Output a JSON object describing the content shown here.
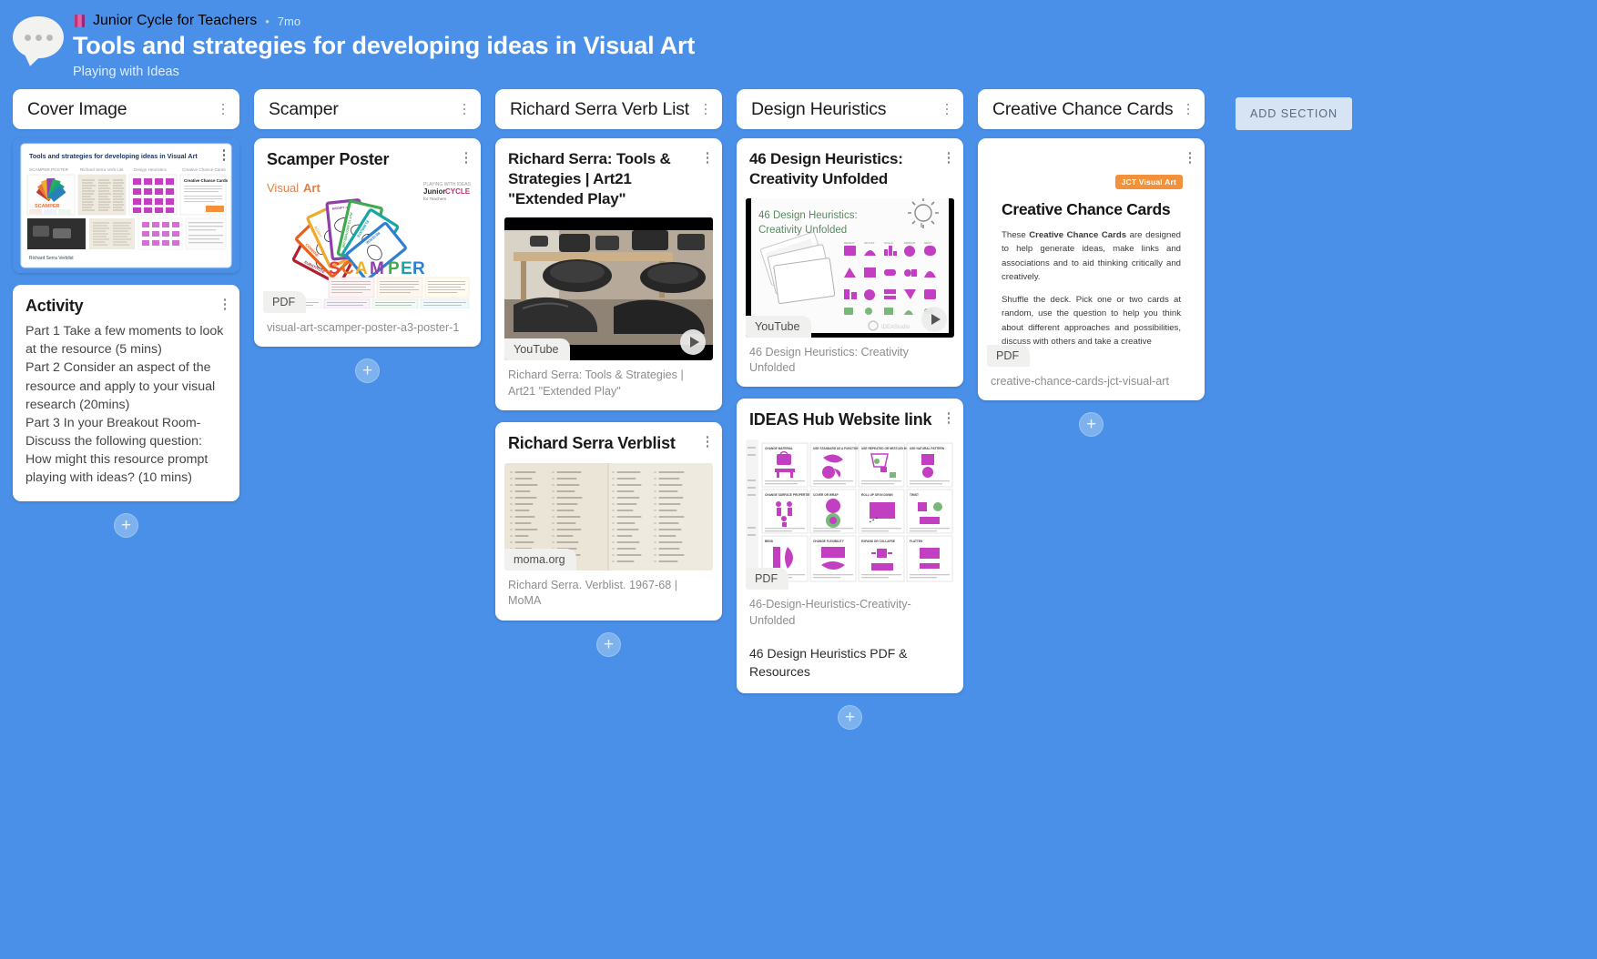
{
  "header": {
    "brand": "Junior Cycle for Teachers",
    "time": "7mo",
    "title": "Tools and strategies for developing ideas in Visual Art",
    "subtitle": "Playing with Ideas",
    "dot": "•",
    "logo_icon": "jct-logo-icon",
    "bubble_icon": "chat-bubble-icon"
  },
  "board": {
    "add_section_label": "ADD SECTION",
    "add_card_label": "+",
    "columns": [
      {
        "title": "Cover Image",
        "cards": [
          {
            "type": "cover",
            "title": "",
            "cover_title": "Tools and strategies for developing ideas in Visual Art",
            "cover_sections": [
              "Scamper",
              "Richard Serra Verb List",
              "Design Heuristics",
              "Creative Chance Cards"
            ],
            "cover_footer": "Richard Serra Verblist"
          },
          {
            "type": "text",
            "title": "Activity",
            "body": "Part 1 Take a few moments to look at the   resource (5 mins)\nPart 2 Consider an aspect of the resource and apply to your visual research (20mins)\nPart 3 In your Breakout Room- Discuss the following question:\nHow might this resource prompt playing with ideas? (10 mins)"
          }
        ]
      },
      {
        "title": "Scamper",
        "cards": [
          {
            "type": "pdf",
            "title": "Scamper Poster",
            "badge": "PDF",
            "caption": "visual-art-scamper-poster-a3-poster-1",
            "poster_label_1": "Visual",
            "poster_label_2": "Art",
            "poster_word": "SCAMPER",
            "poster_brand_1": "Junior",
            "poster_brand_2": "CYCLE",
            "poster_brand_3": "for Teachers",
            "poster_cards": [
              "SUBSTITUTE",
              "COMBINE",
              "ADAPT",
              "MODIFY or MAGNIFY",
              "PUT TO ANOTHER USE",
              "ELIMINATE",
              "REVERSE"
            ]
          }
        ]
      },
      {
        "title": "Richard Serra Verb List",
        "cards": [
          {
            "type": "video",
            "title": "Richard Serra: Tools & Strategies | Art21 \"Extended Play\"",
            "badge": "YouTube",
            "caption": "Richard Serra: Tools & Strategies | Art21 \"Extended Play\"",
            "play_icon": "play-icon"
          },
          {
            "type": "link",
            "title": "Richard Serra Verblist",
            "badge": "moma.org",
            "caption": "Richard Serra. Verblist. 1967-68 | MoMA"
          }
        ]
      },
      {
        "title": "Design Heuristics",
        "cards": [
          {
            "type": "video",
            "title": "46 Design Heuristics: Creativity Unfolded",
            "thumb_title": "46 Design Heuristics:\nCreativity Unfolded",
            "thumb_brand": "IDEAStudio",
            "badge": "YouTube",
            "caption": "46 Design Heuristics: Creativity Unfolded",
            "play_icon": "play-icon"
          },
          {
            "type": "pdf",
            "title": "IDEAS Hub Website link",
            "badge": "PDF",
            "caption": "46-Design-Heuristics-Creativity-Unfolded",
            "subtitle": "46 Design Heuristics PDF & Resources"
          }
        ]
      },
      {
        "title": "Creative Chance Cards",
        "cards": [
          {
            "type": "pdf",
            "title": "",
            "badge": "PDF",
            "caption": "creative-chance-cards-jct-visual-art",
            "doc_logo": "JCT Visual Art",
            "doc_heading": "Creative Chance Cards",
            "doc_p1_pre": "These ",
            "doc_p1_bold": "Creative Chance Cards",
            "doc_p1_post": " are designed to help generate ideas, make links and associations and to aid thinking critically and creatively.",
            "doc_p2": "Shuffle the deck. Pick one or two cards at random, use the question to help you think about different approaches and possibilities, discuss with others and take a creative"
          }
        ]
      }
    ]
  },
  "colors": {
    "background": "#4a90e8",
    "card": "#ffffff",
    "accent": "#7eb2ee",
    "add_section_bg": "#d6e4f4"
  }
}
